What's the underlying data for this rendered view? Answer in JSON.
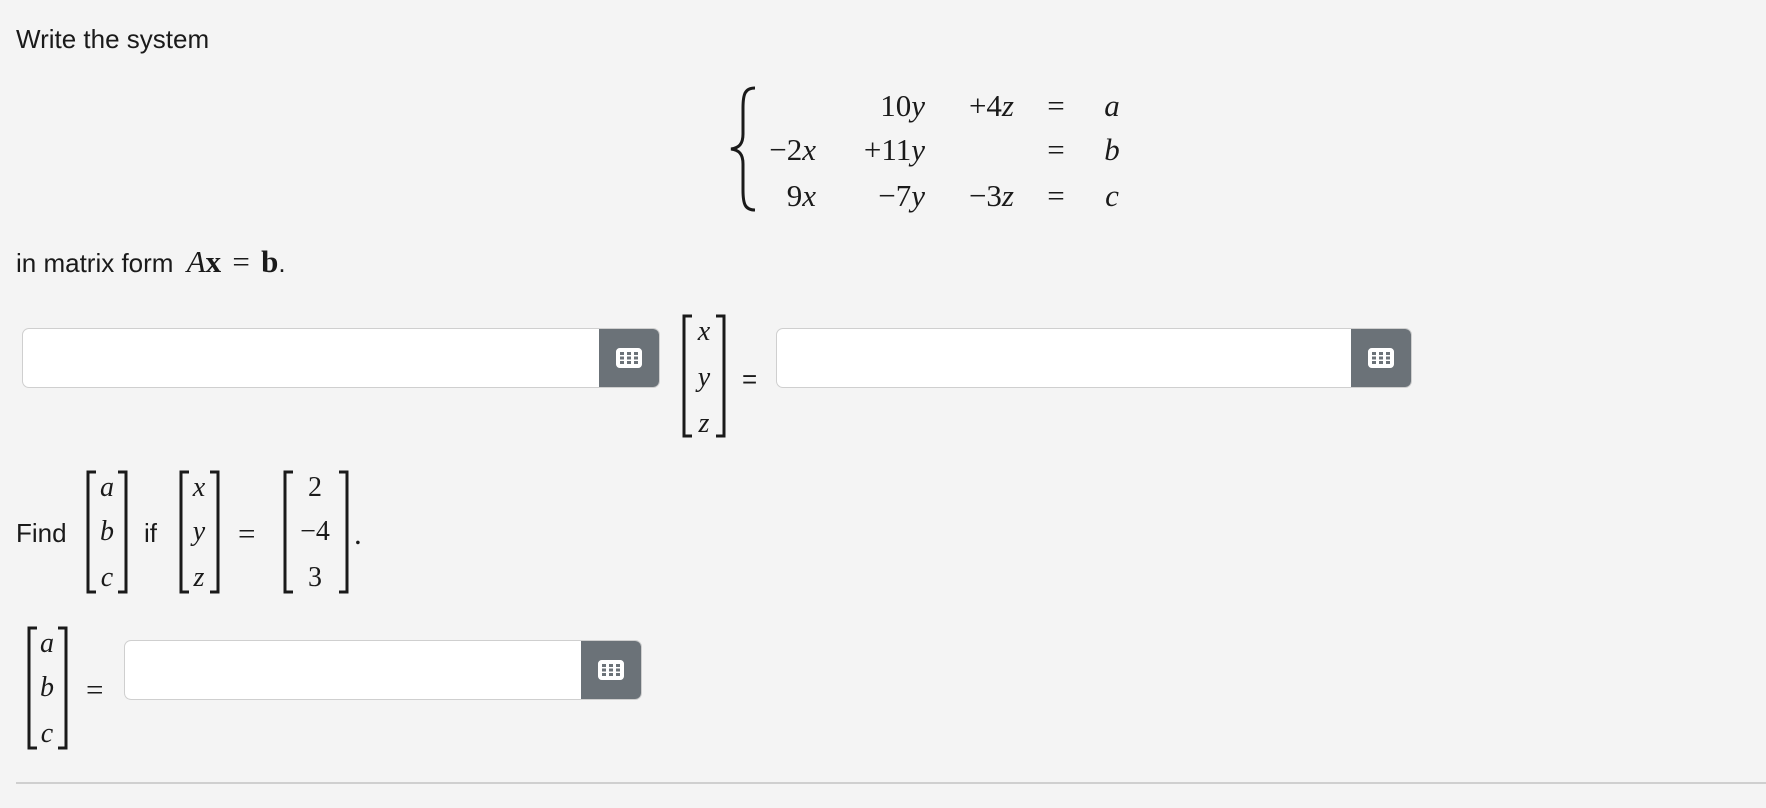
{
  "question": {
    "prompt_part1": "Write the system",
    "prompt_part2_prefix": "in matrix form",
    "prompt_part2_math_A": "A",
    "prompt_part2_math_x": "x",
    "prompt_part2_math_eq": "=",
    "prompt_part2_math_b": "b",
    "prompt_part2_period": "."
  },
  "system": {
    "rows": [
      {
        "x_term": "",
        "y_term": "10y",
        "z_term": "+4z",
        "eq": "=",
        "rhs": "a"
      },
      {
        "x_term": "−2x",
        "y_term": "+11y",
        "z_term": "",
        "eq": "=",
        "rhs": "b"
      },
      {
        "x_term": "9x",
        "y_term": "−7y",
        "z_term": "−3z",
        "eq": "=",
        "rhs": "c"
      }
    ]
  },
  "matrix_equation": {
    "A_input_value": "",
    "vector_entries": [
      "x",
      "y",
      "z"
    ],
    "equals": "=",
    "b_input_value": ""
  },
  "find_part": {
    "find_label": "Find",
    "unknown_vector": [
      "a",
      "b",
      "c"
    ],
    "if_label": "if",
    "xyz_vector": [
      "x",
      "y",
      "z"
    ],
    "equals": "=",
    "given_values": [
      "2",
      "−4",
      "3"
    ],
    "period": "."
  },
  "answer": {
    "abc_vector": [
      "a",
      "b",
      "c"
    ],
    "equals": "=",
    "answer_input_value": ""
  },
  "icons": {
    "keyboard": "matrix-keypad-icon"
  }
}
